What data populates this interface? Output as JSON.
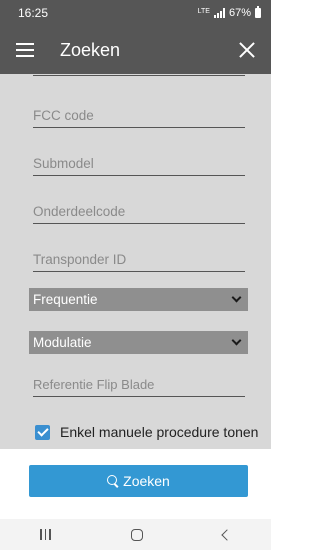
{
  "status_bar": {
    "time": "16:25",
    "network": "LTE",
    "battery": "67%"
  },
  "app_bar": {
    "title": "Zoeken"
  },
  "form": {
    "fields": [
      {
        "placeholder": "FCC code"
      },
      {
        "placeholder": "Submodel"
      },
      {
        "placeholder": "Onderdeelcode"
      },
      {
        "placeholder": "Transponder ID"
      }
    ],
    "frequency_select": {
      "value": "Frequentie"
    },
    "modulation_select": {
      "value": "Modulatie"
    },
    "flip_blade_field": {
      "placeholder": "Referentie Flip Blade"
    },
    "manual_checkbox": {
      "label": "Enkel manuele procedure tonen",
      "checked": true
    }
  },
  "actions": {
    "search_label": "Zoeken"
  },
  "colors": {
    "app_bar": "#565656",
    "form_background": "#d8d8d8",
    "select_background": "#8f8f8f",
    "accent": "#3398d3",
    "checkbox": "#3a8fd0"
  }
}
